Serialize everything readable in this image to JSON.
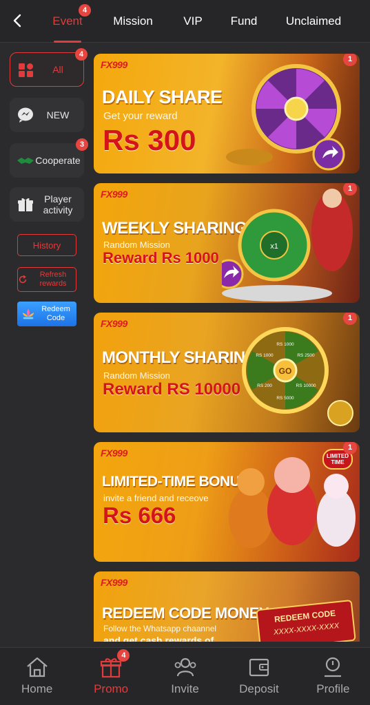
{
  "header": {
    "tabs": [
      {
        "label": "Event",
        "badge": "4"
      },
      {
        "label": "Mission"
      },
      {
        "label": "VIP"
      },
      {
        "label": "Fund"
      },
      {
        "label": "Unclaimed"
      }
    ]
  },
  "sidebar": {
    "items": [
      {
        "label": "All",
        "badge": "4",
        "icon": "grid-icon"
      },
      {
        "label": "NEW",
        "icon": "chat-icon"
      },
      {
        "label": "Cooperate",
        "badge": "3",
        "icon": "handshake-icon"
      },
      {
        "label": "Player activity",
        "icon": "gift-icon"
      }
    ],
    "history_label": "History",
    "refresh_label": "Refresh rewards",
    "redeem_label": "Redeem Code"
  },
  "banners": [
    {
      "brand": "FX999",
      "title": "DAILY SHARE",
      "subtitle": "Get your reward",
      "reward": "Rs 300",
      "badge": "1"
    },
    {
      "brand": "FX999",
      "title": "WEEKLY SHARING",
      "subtitle": "Random Mission",
      "reward": "Reward Rs 1000",
      "badge": "1"
    },
    {
      "brand": "FX999",
      "title": "MONTHLY SHARING",
      "subtitle": "Random Mission",
      "reward": "Reward RS 10000",
      "badge": "1"
    },
    {
      "brand": "FX999",
      "title": "LIMITED-TIME BONUS",
      "subtitle": "invite a friend and receove",
      "reward": "Rs 666",
      "badge": "1",
      "tag": "LIMITED TIME"
    },
    {
      "brand": "FX999",
      "title": "REDEEM CODE MONEY",
      "subtitle": "Follow the Whatsapp chaannel",
      "extra": "and get cash rewards of",
      "code_title": "REDEEM CODE",
      "code_value": "XXXX-XXXX-XXXX"
    }
  ],
  "wheel_labels": {
    "weekly_center": "x1",
    "monthly_center": "GO",
    "monthly_slices": [
      "RS 1000",
      "RS 2500",
      "RS 10000",
      "RS 5000",
      "RS 200",
      "RS 1000"
    ]
  },
  "bottomnav": {
    "items": [
      {
        "label": "Home",
        "icon": "home-icon"
      },
      {
        "label": "Promo",
        "icon": "gift-icon",
        "badge": "4",
        "active": true
      },
      {
        "label": "Invite",
        "icon": "invite-icon"
      },
      {
        "label": "Deposit",
        "icon": "wallet-icon"
      },
      {
        "label": "Profile",
        "icon": "profile-icon"
      }
    ]
  },
  "colors": {
    "accent": "#e33b3b",
    "background": "#2b2b2d",
    "banner_orange": "#f4a80c",
    "reward_red": "#d3141a"
  }
}
